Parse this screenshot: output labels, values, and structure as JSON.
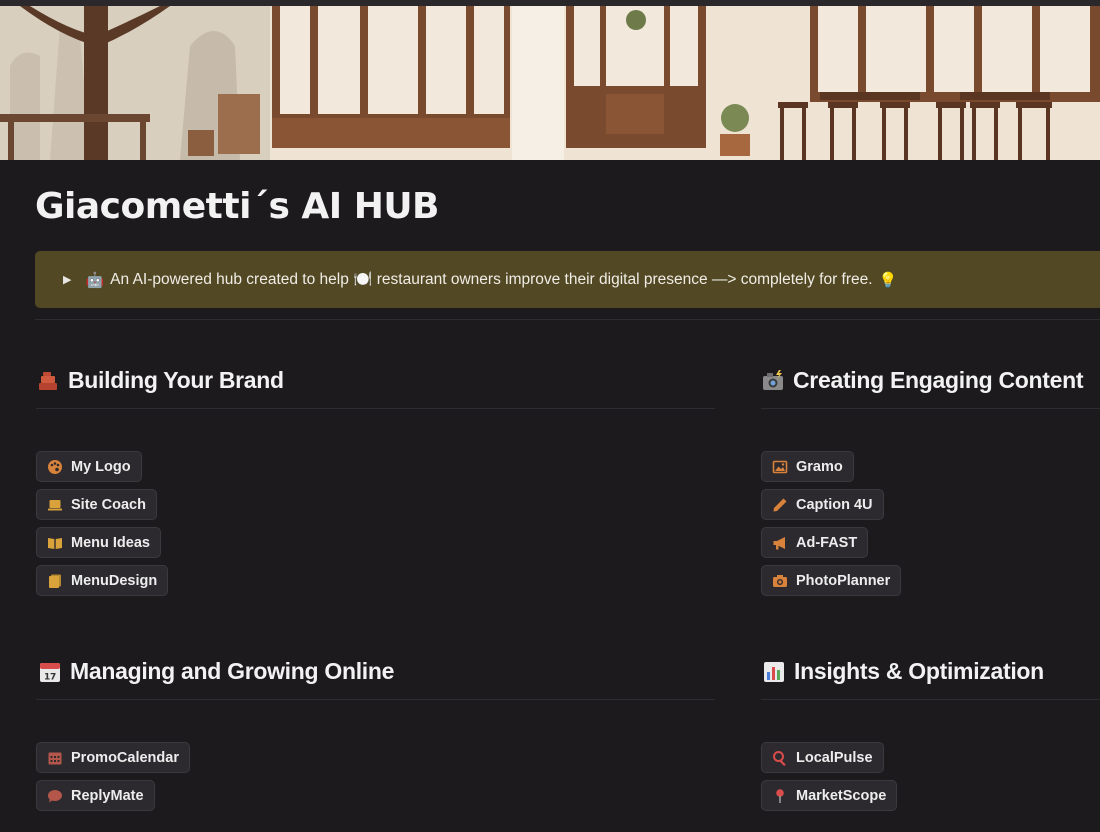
{
  "page": {
    "title": "Giacometti´s AI HUB",
    "callout_text": "An AI-powered hub created to help 🍽️ restaurant owners improve their digital presence —> completely for free.",
    "callout_icon_start": "robot-icon",
    "callout_icon_end": "lightbulb-icon",
    "callout_bg": "#524824"
  },
  "sections": {
    "brand": {
      "heading": "Building Your Brand",
      "icon": "bricks-icon",
      "buttons": [
        {
          "label": "My Logo",
          "icon": "palette-icon"
        },
        {
          "label": "Site Coach",
          "icon": "laptop-icon"
        },
        {
          "label": "Menu Ideas",
          "icon": "open-book-icon"
        },
        {
          "label": "MenuDesign",
          "icon": "notebook-icon"
        }
      ]
    },
    "content": {
      "heading": "Creating Engaging Content",
      "icon": "camera-flash-icon",
      "buttons": [
        {
          "label": "Gramo",
          "icon": "image-icon"
        },
        {
          "label": "Caption 4U",
          "icon": "pencil-icon"
        },
        {
          "label": "Ad-FAST",
          "icon": "megaphone-icon"
        },
        {
          "label": "PhotoPlanner",
          "icon": "camera-icon"
        }
      ]
    },
    "online": {
      "heading": "Managing and Growing Online",
      "icon": "calendar-icon",
      "buttons": [
        {
          "label": "PromoCalendar",
          "icon": "calendar-grid-icon"
        },
        {
          "label": "ReplyMate",
          "icon": "speech-bubble-icon"
        }
      ]
    },
    "insights": {
      "heading": "Insights & Optimization",
      "icon": "bar-chart-icon",
      "buttons": [
        {
          "label": "LocalPulse",
          "icon": "search-icon"
        },
        {
          "label": "MarketScope",
          "icon": "pin-icon"
        }
      ]
    }
  },
  "colors": {
    "accent_orange": "#d9823b",
    "accent_red": "#d94c4c",
    "background": "#1c1a1d"
  }
}
